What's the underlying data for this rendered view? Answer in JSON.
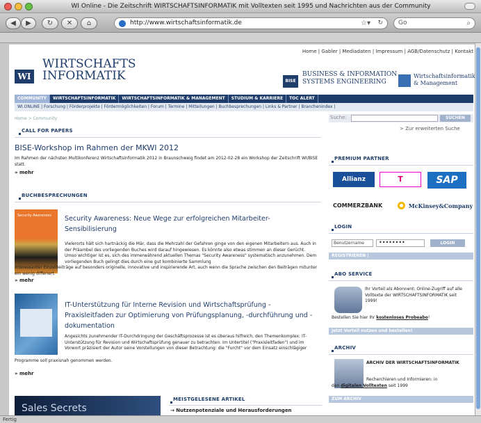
{
  "window": {
    "title": "WI Online - Die Zeitschrift WIRTSCHAFTSINFORMATIK mit Volltexten seit 1995 und Nachrichten aus der Community"
  },
  "toolbar": {
    "url": "http://www.wirtschaftsinformatik.de",
    "search_placeholder": "Go"
  },
  "status": {
    "text": "Fertig"
  },
  "colors": {
    "brand": "#1f3d6b",
    "accent": "#b7c7dd"
  },
  "site": {
    "top_links": "Home | Gabler | Mediadaten | Impressum | AGB/Datenschutz | Kontakt",
    "logo_mark": "WI",
    "logo_line1": "WIRTSCHAFTS",
    "logo_line2": "INFORMATIK",
    "bise_mark": "BISE",
    "bise_line1": "BUSINESS & INFORMATION",
    "bise_line2": "SYSTEMS ENGINEERING",
    "wim_line1": "Wirtschaftsinformatik",
    "wim_line2": "& Management"
  },
  "nav_main": [
    "COMMUNITY",
    "WIRTSCHAFTSINFORMATIK",
    "WIRTSCHAFTSINFORMATIK & MANAGEMENT",
    "STUDIUM & KARRIERE",
    "TOC ALERT"
  ],
  "nav_sub": "WI.ONLINE | Forschung | Förderprojekte | Fördermöglichkeiten | Forum | Termine | Mitteilungen | Buchbesprechungen | Links & Partner | Branchenindex |",
  "breadcrumb": "Home > Community",
  "call": {
    "heading": "CALL FOR PAPERS",
    "title": "BISE-Workshop im Rahmen der MKWI 2012",
    "text": "Im Rahmen der nächsten Multikonferenz Wirtschaftsinformatik 2012 in Braunschweig findet am 2012-02-28 ein Workshop der Zeitschrift WI/BISE statt.",
    "more": "» mehr"
  },
  "books": {
    "heading": "BUCHBESPRECHUNGEN",
    "items": [
      {
        "title": "Security Awareness: Neue Wege zur erfolgreichen Mitarbeiter-Sensibilisierung",
        "text_indent": "Vielerorts hält sich hartnäckig die Mär, dass die Mehrzahl der Gefahren ginge von den eigenen Mitarbeitern aus. Auch in der Präambel des vorliegenden Buches wird darauf hingewiesen. Es könnte also etwas stimmen an dieser Gerücht. Umso wichtiger ist es, sich des immerwährend aktuellen Themas \"Security Awareness\" systematisch anzunehmen. Dem vorliegenden Buch gelingt dies durch eine gut kombinierte Sammlung",
        "text_full": "interessanter Einzelbeiträge auf besonders originelle, innovative und inspirierende Art, auch wenn die Sprache zwischen den Beiträgen mitunter ein wenig differiert.",
        "more": "» mehr",
        "cover_title": "Security Awareness"
      },
      {
        "title": "IT-Unterstützung für Interne Revision und Wirtschaftsprüfung - Praxisleitfaden zur Optimierung von Prüfungsplanung, -durchführung und -dokumentation",
        "text_indent": "Angesichts zunehmender IT-Durchdringung der Geschäftsprozesse ist es überaus hilfreich, den Themenkomplex: IT-Unterstützung für Revision und Wirtschaftsprüfung genauer zu betrachten. Im Untertitel (\"Praxisleitfaden\") und im Vorwort präzisiert der Autor seine Vorstellungen von dieser Betrachtung: die \"Furcht\" vor dem Einsatz einschlägiger",
        "text_full": "Programme soll praxisnah genommen werden.",
        "more": "» mehr"
      }
    ]
  },
  "promo": {
    "text": "Sales Secrets"
  },
  "most_read": {
    "heading": "MEISTGELESENE ARTIKEL",
    "first": "→ Nutzenpotenziale und Herausforderungen"
  },
  "right": {
    "search_label": "Suche:",
    "search_button": "SUCHEN",
    "extended": "> Zur erweiterten Suche",
    "partner_heading": "PREMIUM PARTNER",
    "partners": [
      "Allianz",
      "T",
      "SAP",
      "COMMERZBANK",
      "McKinsey&Company"
    ],
    "login_heading": "LOGIN",
    "username": "Benutzername",
    "password": "••••••••",
    "login_button": "LOGIN",
    "register": "REGISTRIEREN |",
    "abo_heading": "ABO SERVICE",
    "abo_text": "Ihr Vorteil als Abonnent: Online-Zugriff auf alle Volltexte der WIRTSCHAFTSINFORMATIK seit 1999!",
    "abo_order_prefix": "Bestellen Sie hier Ihr ",
    "abo_order_link": "kostenloses Probeabo",
    "abo_order_suffix": "!",
    "abo_bar": "Jetzt Vorteil nutzen und bestellen!",
    "archiv_heading": "ARCHIV",
    "archiv_title": "ARCHIV DER WIRTSCHAFTSINFORMATIK",
    "archiv_text1": "Recherchieren und Informieren: in",
    "archiv_text2_prefix": "den ",
    "archiv_link": "digitalen Volltexten",
    "archiv_text2_suffix": " seit 1999",
    "archiv_bar": "ZUM ARCHIV"
  }
}
